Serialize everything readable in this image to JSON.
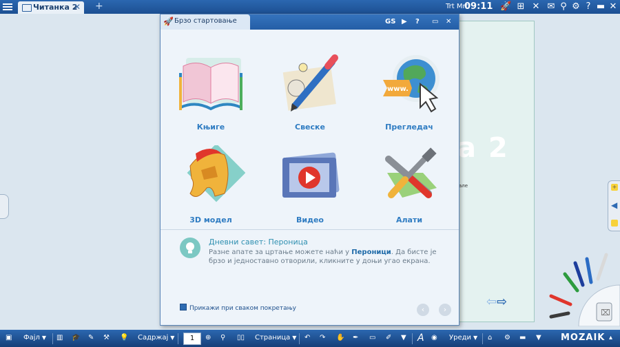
{
  "topbar": {
    "tab_label": "Читанка 2",
    "tab_close": "✕",
    "add_tab": "+",
    "user": "Trt Mrt",
    "time": "09:11",
    "icons": [
      "rocket-icon",
      "screens-icon",
      "collapse-icon",
      "mail-icon",
      "search-icon",
      "settings-icon",
      "help-icon",
      "minimize-icon",
      "restore-icon",
      "close-icon"
    ]
  },
  "page": {
    "big_text": "a 2",
    "small_text": "але"
  },
  "dialog": {
    "title": "Брзо стартовање",
    "controls": [
      "GS",
      "⚙",
      "?",
      "▭",
      "✕"
    ],
    "items": [
      {
        "label": "Књиге",
        "icon": "books-icon"
      },
      {
        "label": "Свеске",
        "icon": "notebooks-icon"
      },
      {
        "label": "Прегледач",
        "icon": "browser-icon"
      },
      {
        "label": "3D модел",
        "icon": "3d-model-icon"
      },
      {
        "label": "Видео",
        "icon": "video-icon"
      },
      {
        "label": "Алати",
        "icon": "tools-icon"
      }
    ],
    "tip_title": "Дневни савет: Пероница",
    "tip_text_1": "Разне апате за цртање можете наћи у ",
    "tip_text_bold": "Пероници",
    "tip_text_2": ". Да бисте је брзо и једноставно отворили, кликните у доњи угао екрана.",
    "checkbox_label": "Прикажи при сваком покретању",
    "prev": "‹",
    "next": "›"
  },
  "bottombar": {
    "file": "Фајл",
    "content": "Садржај",
    "page_number": "1",
    "page": "Страница",
    "devices": "Уреди",
    "logo": "MOZAIK"
  },
  "colors": {
    "bar_blue": "#2b67b0",
    "label_blue": "#2f7cc2",
    "tip_teal": "#7cc8c3"
  }
}
